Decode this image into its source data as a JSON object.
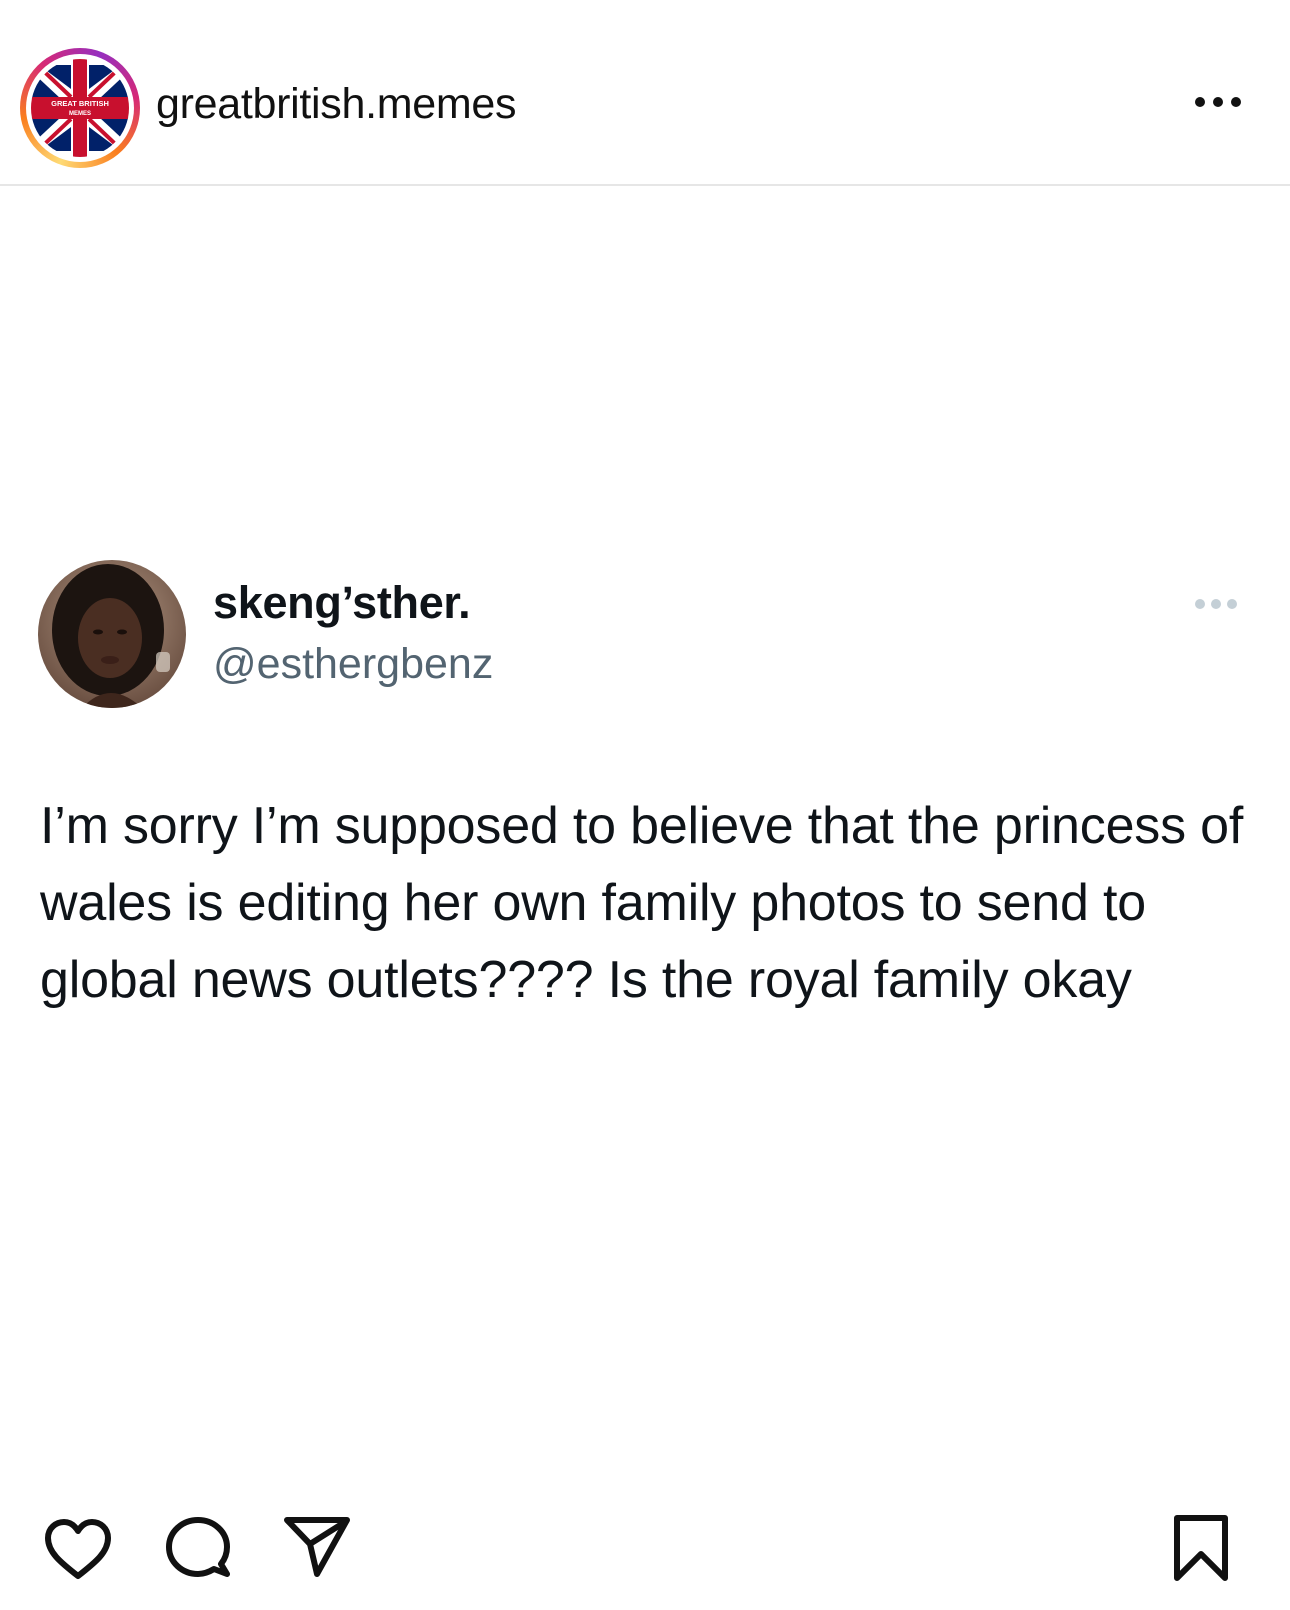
{
  "post": {
    "account_username": "greatbritish.memes",
    "avatar_badge_text": "GREAT BRITISH MEMES",
    "more_icon": "more-horizontal-icon"
  },
  "tweet": {
    "display_name": "skeng’sther.",
    "handle": "@esthergbenz",
    "text": "I’m sorry I’m supposed to believe that the princess of wales is editing her own family photos to send to global news outlets???? Is the royal family okay",
    "more_icon": "more-horizontal-icon"
  },
  "actions": {
    "like_icon": "heart-icon",
    "comment_icon": "comment-icon",
    "share_icon": "paper-plane-icon",
    "save_icon": "bookmark-icon"
  },
  "colors": {
    "name": "#0f1419",
    "handle": "#536471",
    "union_red": "#c8102e",
    "union_blue": "#012169"
  }
}
